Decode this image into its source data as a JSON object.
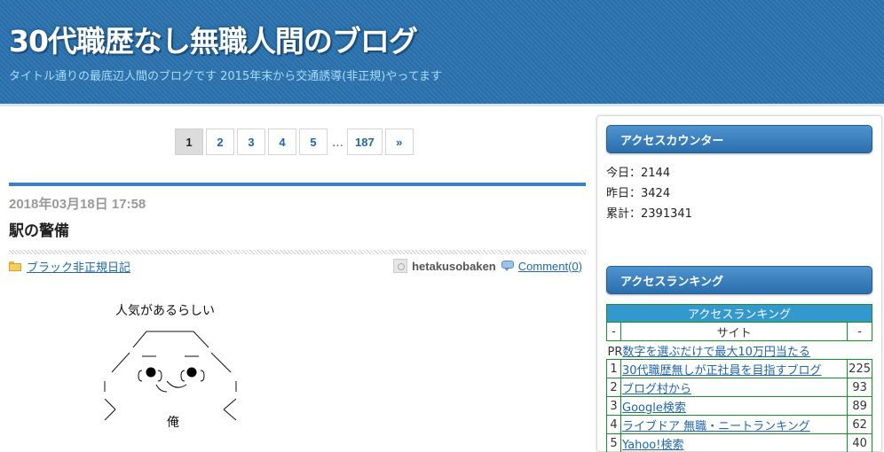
{
  "header": {
    "title": "30代職歴なし無職人間のブログ",
    "description": "タイトル通りの最底辺人間のブログです 2015年末から交通誘導(非正規)やってます"
  },
  "pagination": {
    "pages": [
      "1",
      "2",
      "3",
      "4",
      "5"
    ],
    "ellipsis": "…",
    "last": "187",
    "next": "»"
  },
  "article": {
    "date": "2018年03月18日 17:58",
    "title": "駅の警備",
    "category": "ブラック非正規日記",
    "author": "hetakusobaken",
    "comments": "Comment(0)",
    "aa_caption": "人気があるらしい",
    "aa_label": "俺"
  },
  "sidebar": {
    "counter_title": "アクセスカウンター",
    "counter": {
      "today": "今日：2144",
      "yesterday": "昨日：3424",
      "total": "累計：2391341"
    },
    "ranking_title": "アクセスランキング",
    "ranking_table": {
      "caption": "アクセスランキング",
      "header": [
        "-",
        "サイト",
        "-"
      ],
      "pr": {
        "label": "PR",
        "site": "数字を選ぶだけで最大10万円当たる"
      },
      "rows": [
        {
          "rank": "1",
          "site": "30代職歴無しが正社員を目指すブログ",
          "count": "225"
        },
        {
          "rank": "2",
          "site": "ブログ村から",
          "count": "93"
        },
        {
          "rank": "3",
          "site": "Google検索",
          "count": "89"
        },
        {
          "rank": "4",
          "site": "ライブドア 無職・ニートランキング",
          "count": "62"
        },
        {
          "rank": "5",
          "site": "Yahoo!検索",
          "count": "40"
        }
      ]
    }
  }
}
